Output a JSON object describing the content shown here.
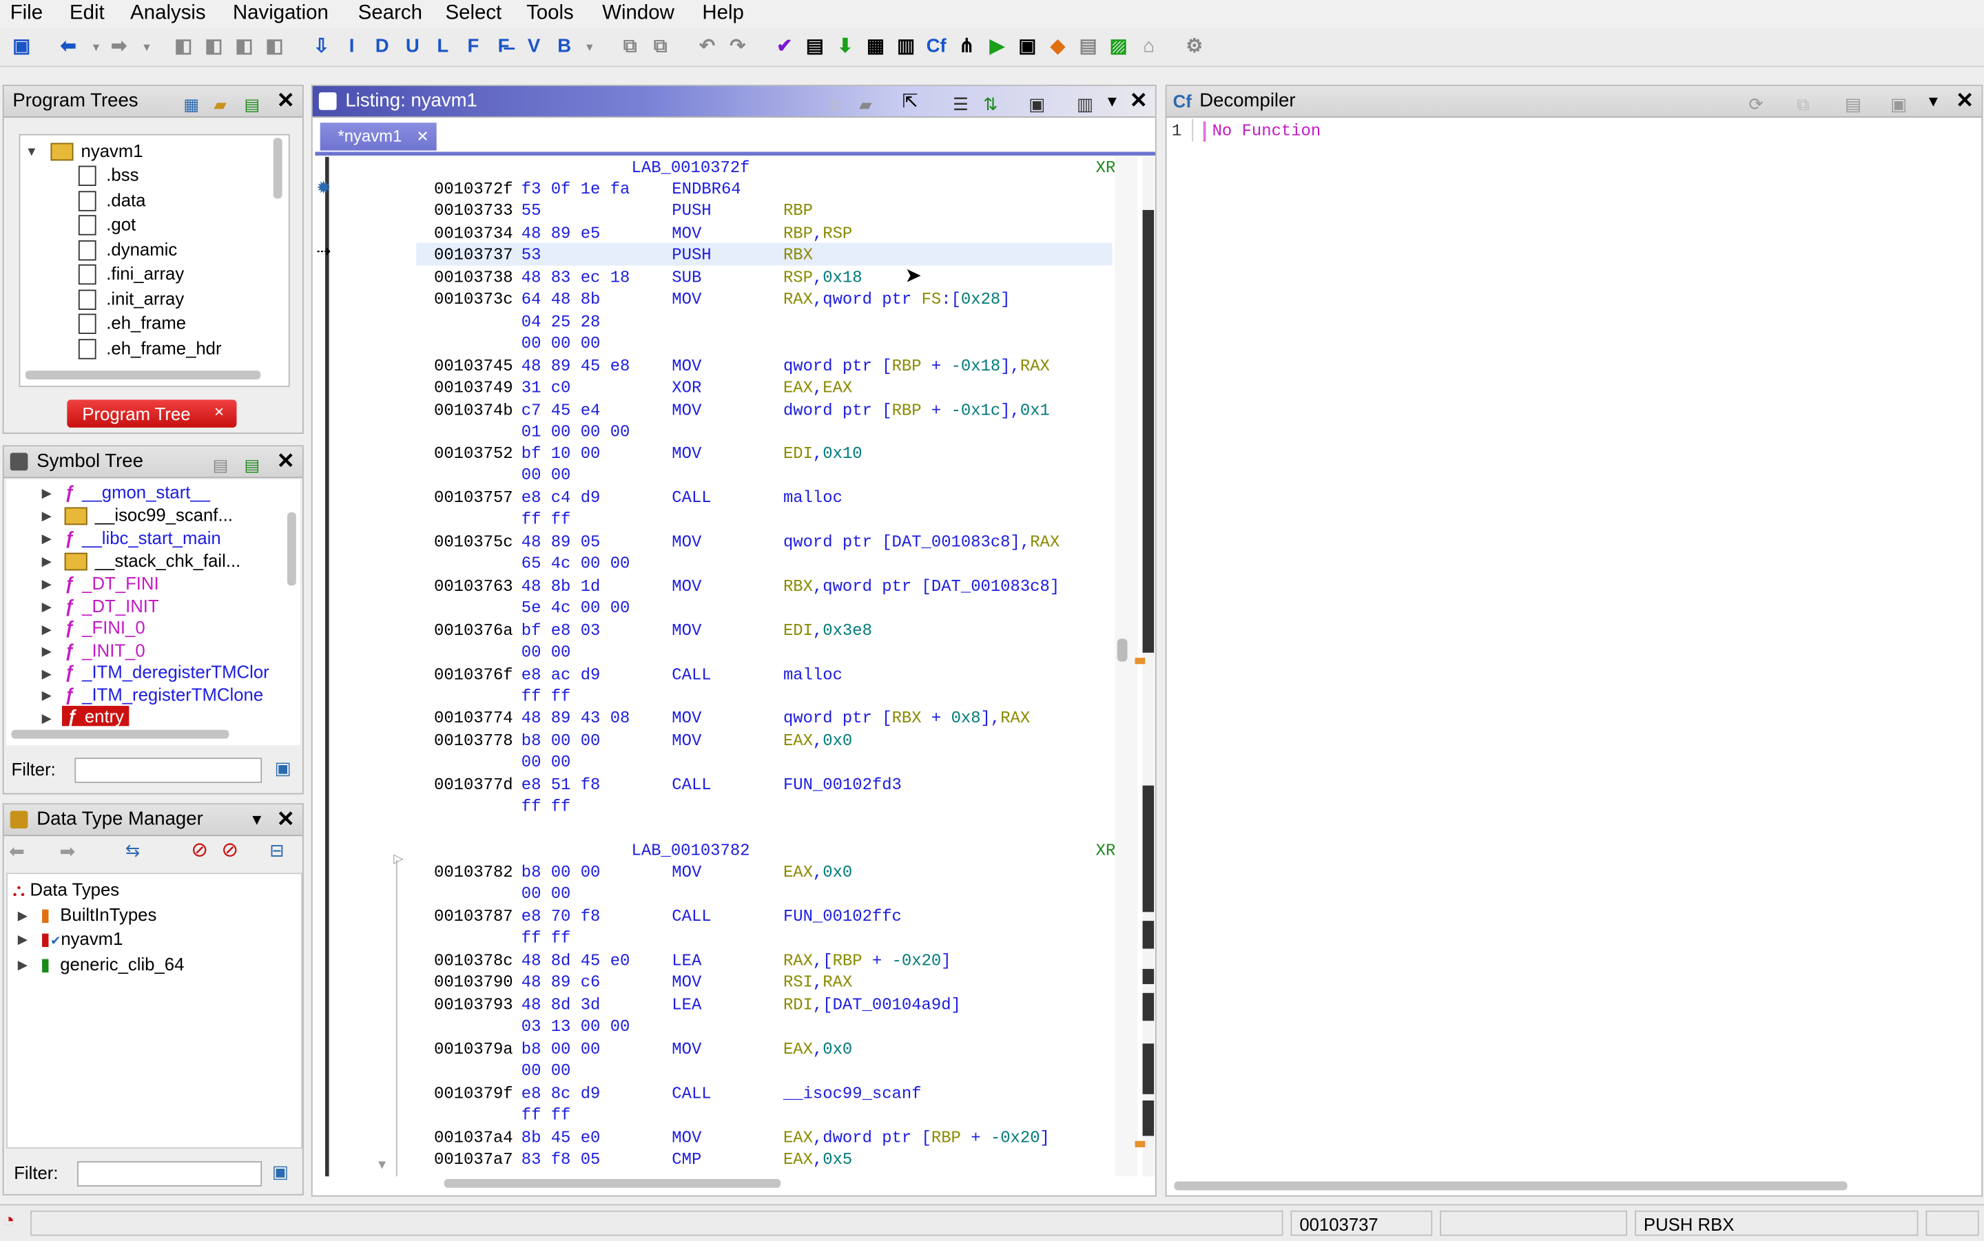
{
  "menu": [
    "File",
    "Edit",
    "Analysis",
    "Navigation",
    "Search",
    "Select",
    "Tools",
    "Window",
    "Help"
  ],
  "toolbar": {
    "icons": [
      "save-icon",
      "back-arrow-icon",
      "forward-arrow-icon",
      "nav-icon-1",
      "nav-icon-2",
      "nav-icon-3",
      "nav-icon-4",
      "next-down-icon",
      "I",
      "D",
      "U",
      "L",
      "F",
      "F-bar",
      "V",
      "B",
      "copy-icon",
      "paste-icon",
      "undo-icon",
      "redo-icon",
      "check-icon",
      "script-icon",
      "export-icon",
      "table-icon",
      "bytes-icon",
      "cf-icon",
      "graph-icon",
      "run-icon",
      "memory-icon",
      "diamond-icon",
      "datatype-icon",
      "chart-icon",
      "plugin-icon",
      "settings-icon"
    ]
  },
  "program_trees": {
    "title": "Program Trees",
    "root": "nyavm1",
    "items": [
      ".bss",
      ".data",
      ".got",
      ".dynamic",
      ".fini_array",
      ".init_array",
      ".eh_frame",
      ".eh_frame_hdr"
    ],
    "tab": "Program Tree"
  },
  "symbol_tree": {
    "title": "Symbol Tree",
    "items": [
      "__gmon_start__",
      "__isoc99_scanf...",
      "__libc_start_main",
      "__stack_chk_fail...",
      "_DT_FINI",
      "_DT_INIT",
      "_FINI_0",
      "_INIT_0",
      "_ITM_deregisterTMClor",
      "_ITM_registerTMClone",
      "entry"
    ],
    "filter_label": "Filter:"
  },
  "data_type_manager": {
    "title": "Data Type Manager",
    "root": "Data Types",
    "items": [
      "BuiltInTypes",
      "nyavm1",
      "generic_clib_64"
    ],
    "filter_label": "Filter:"
  },
  "listing": {
    "title": "Listing:  nyavm1",
    "tab": "*nyavm1",
    "labels": [
      {
        "text": "LAB_0010372f",
        "xref": "XR"
      },
      {
        "text": "LAB_00103782",
        "xref": "XR"
      }
    ],
    "rows": [
      {
        "addr": "0010372f",
        "bytes": "f3 0f 1e fa",
        "mnem": "ENDBR64",
        "ops": ""
      },
      {
        "addr": "00103733",
        "bytes": "55",
        "mnem": "PUSH",
        "ops": "RBP"
      },
      {
        "addr": "00103734",
        "bytes": "48 89 e5",
        "mnem": "MOV",
        "ops": "RBP,RSP"
      },
      {
        "addr": "00103737",
        "bytes": "53",
        "mnem": "PUSH",
        "ops": "RBX"
      },
      {
        "addr": "00103738",
        "bytes": "48 83 ec 18",
        "mnem": "SUB",
        "ops": "RSP,0x18"
      },
      {
        "addr": "0010373c",
        "bytes": "64 48 8b",
        "mnem": "MOV",
        "ops": "RAX,qword ptr FS:[0x28]"
      },
      {
        "addr": "",
        "bytes": "04 25 28",
        "mnem": "",
        "ops": ""
      },
      {
        "addr": "",
        "bytes": "00 00 00",
        "mnem": "",
        "ops": ""
      },
      {
        "addr": "00103745",
        "bytes": "48 89 45 e8",
        "mnem": "MOV",
        "ops": "qword ptr [RBP + -0x18],RAX"
      },
      {
        "addr": "00103749",
        "bytes": "31 c0",
        "mnem": "XOR",
        "ops": "EAX,EAX"
      },
      {
        "addr": "0010374b",
        "bytes": "c7 45 e4",
        "mnem": "MOV",
        "ops": "dword ptr [RBP + -0x1c],0x1"
      },
      {
        "addr": "",
        "bytes": "01 00 00 00",
        "mnem": "",
        "ops": ""
      },
      {
        "addr": "00103752",
        "bytes": "bf 10 00",
        "mnem": "MOV",
        "ops": "EDI,0x10"
      },
      {
        "addr": "",
        "bytes": "00 00",
        "mnem": "",
        "ops": ""
      },
      {
        "addr": "00103757",
        "bytes": "e8 c4 d9",
        "mnem": "CALL",
        "ops": "malloc"
      },
      {
        "addr": "",
        "bytes": "ff ff",
        "mnem": "",
        "ops": ""
      },
      {
        "addr": "0010375c",
        "bytes": "48 89 05",
        "mnem": "MOV",
        "ops": "qword ptr [DAT_001083c8],RAX"
      },
      {
        "addr": "",
        "bytes": "65 4c 00 00",
        "mnem": "",
        "ops": ""
      },
      {
        "addr": "00103763",
        "bytes": "48 8b 1d",
        "mnem": "MOV",
        "ops": "RBX,qword ptr [DAT_001083c8]"
      },
      {
        "addr": "",
        "bytes": "5e 4c 00 00",
        "mnem": "",
        "ops": ""
      },
      {
        "addr": "0010376a",
        "bytes": "bf e8 03",
        "mnem": "MOV",
        "ops": "EDI,0x3e8"
      },
      {
        "addr": "",
        "bytes": "00 00",
        "mnem": "",
        "ops": ""
      },
      {
        "addr": "0010376f",
        "bytes": "e8 ac d9",
        "mnem": "CALL",
        "ops": "malloc"
      },
      {
        "addr": "",
        "bytes": "ff ff",
        "mnem": "",
        "ops": ""
      },
      {
        "addr": "00103774",
        "bytes": "48 89 43 08",
        "mnem": "MOV",
        "ops": "qword ptr [RBX + 0x8],RAX"
      },
      {
        "addr": "00103778",
        "bytes": "b8 00 00",
        "mnem": "MOV",
        "ops": "EAX,0x0"
      },
      {
        "addr": "",
        "bytes": "00 00",
        "mnem": "",
        "ops": ""
      },
      {
        "addr": "0010377d",
        "bytes": "e8 51 f8",
        "mnem": "CALL",
        "ops": "FUN_00102fd3"
      },
      {
        "addr": "",
        "bytes": "ff ff",
        "mnem": "",
        "ops": ""
      },
      {
        "addr": "00103782",
        "bytes": "b8 00 00",
        "mnem": "MOV",
        "ops": "EAX,0x0"
      },
      {
        "addr": "",
        "bytes": "00 00",
        "mnem": "",
        "ops": ""
      },
      {
        "addr": "00103787",
        "bytes": "e8 70 f8",
        "mnem": "CALL",
        "ops": "FUN_00102ffc"
      },
      {
        "addr": "",
        "bytes": "ff ff",
        "mnem": "",
        "ops": ""
      },
      {
        "addr": "0010378c",
        "bytes": "48 8d 45 e0",
        "mnem": "LEA",
        "ops": "RAX,[RBP + -0x20]"
      },
      {
        "addr": "00103790",
        "bytes": "48 89 c6",
        "mnem": "MOV",
        "ops": "RSI,RAX"
      },
      {
        "addr": "00103793",
        "bytes": "48 8d 3d",
        "mnem": "LEA",
        "ops": "RDI,[DAT_00104a9d]"
      },
      {
        "addr": "",
        "bytes": "03 13 00 00",
        "mnem": "",
        "ops": ""
      },
      {
        "addr": "0010379a",
        "bytes": "b8 00 00",
        "mnem": "MOV",
        "ops": "EAX,0x0"
      },
      {
        "addr": "",
        "bytes": "00 00",
        "mnem": "",
        "ops": ""
      },
      {
        "addr": "0010379f",
        "bytes": "e8 8c d9",
        "mnem": "CALL",
        "ops": "__isoc99_scanf"
      },
      {
        "addr": "",
        "bytes": "ff ff",
        "mnem": "",
        "ops": ""
      },
      {
        "addr": "001037a4",
        "bytes": "8b 45 e0",
        "mnem": "MOV",
        "ops": "EAX,dword ptr [RBP + -0x20]"
      },
      {
        "addr": "001037a7",
        "bytes": "83 f8 05",
        "mnem": "CMP",
        "ops": "EAX,0x5"
      }
    ]
  },
  "decompiler": {
    "title": "Decompiler",
    "line_no": "1",
    "text": "No Function"
  },
  "status": {
    "address": "00103737",
    "instruction": "PUSH RBX"
  }
}
